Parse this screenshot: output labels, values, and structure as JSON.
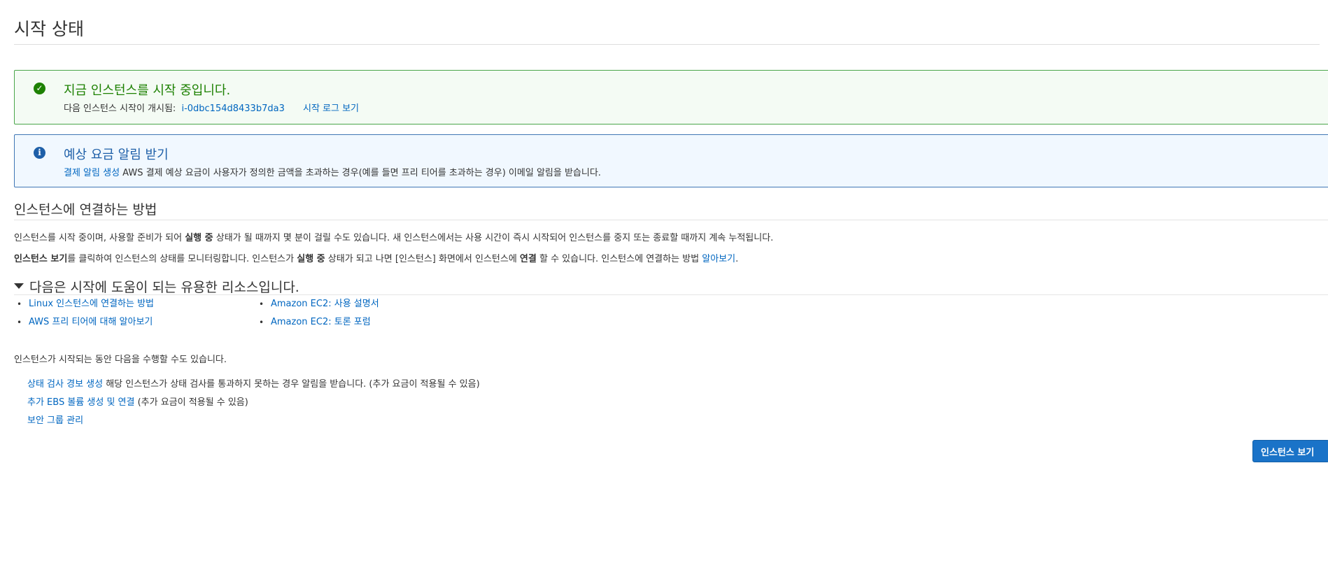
{
  "page": {
    "title": "시작 상태"
  },
  "success_alert": {
    "title": "지금 인스턴스를 시작 중입니다.",
    "body_prefix": "다음 인스턴스 시작이 개시됨:",
    "instance_id": "i-0dbc154d8433b7da3",
    "log_link": "시작 로그 보기"
  },
  "info_alert": {
    "title": "예상 요금 알림 받기",
    "link": "결제 알림 생성",
    "body": "AWS 결제 예상 요금이 사용자가 정의한 금액을 초과하는 경우(예를 들면 프리 티어를 초과하는 경우) 이메일 알림을 받습니다."
  },
  "connect_section": {
    "title": "인스턴스에 연결하는 방법",
    "para1": {
      "a": "인스턴스를 시작 중이며, 사용할 준비가 되어 ",
      "b": "실행 중",
      "c": " 상태가 될 때까지 몇 분이 걸릴 수도 있습니다. 새 인스턴스에서는 사용 시간이 즉시 시작되어 인스턴스를 중지 또는 종료할 때까지 계속 누적됩니다."
    },
    "para2": {
      "b1": "인스턴스 보기",
      "a1": "를 클릭하여 인스턴스의 상태를 모니터링합니다. 인스턴스가 ",
      "b2": "실행 중",
      "a2": " 상태가 되고 나면 [인스턴스] 화면에서 인스턴스에 ",
      "b3": "연결",
      "a3": " 할 수 있습니다. 인스턴스에 연결하는 방법 ",
      "link": "알아보기",
      "end": "."
    }
  },
  "resources": {
    "title": "다음은 시작에 도움이 되는 유용한 리소스입니다.",
    "col1": [
      "Linux 인스턴스에 연결하는 방법",
      "AWS 프리 티어에 대해 알아보기"
    ],
    "col2": [
      "Amazon EC2: 사용 설명서",
      "Amazon EC2: 토론 포럼"
    ]
  },
  "while_launching": {
    "intro": "인스턴스가 시작되는 동안 다음을 수행할 수도 있습니다.",
    "actions": [
      {
        "link": "상태 검사 경보 생성",
        "text": " 해당 인스턴스가 상태 검사를 통과하지 못하는 경우 알림을 받습니다. (추가 요금이 적용될 수 있음)"
      },
      {
        "link": "추가 EBS 볼륨 생성 및 연결",
        "text": " (추가 요금이 적용될 수 있음)"
      },
      {
        "link": "보안 그룹 관리",
        "text": ""
      }
    ]
  },
  "view_instances_button": "인스턴스 보기",
  "colors": {
    "success": "#1d8102",
    "info": "#1e5fa8",
    "link": "#0066c0",
    "primary": "#1a73c8"
  }
}
